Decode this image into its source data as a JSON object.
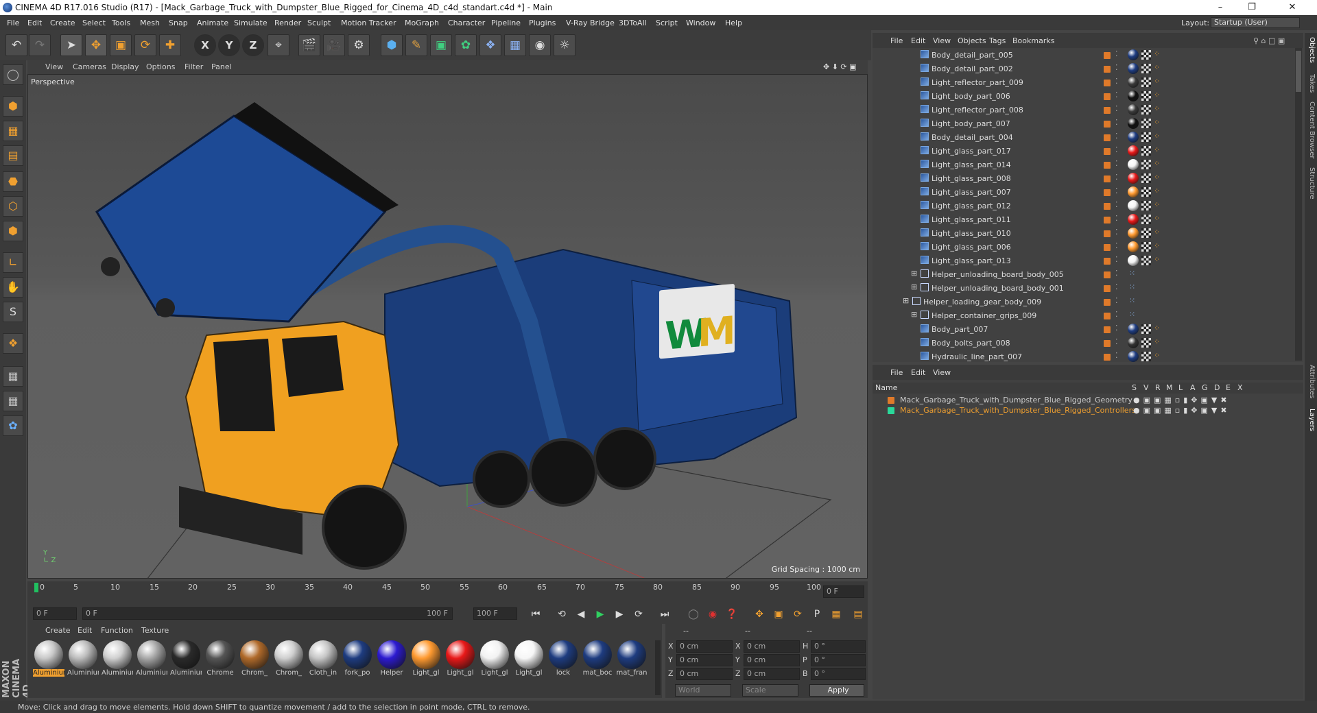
{
  "app": {
    "title": "CINEMA 4D R17.016 Studio (R17) - [Mack_Garbage_Truck_with_Dumpster_Blue_Rigged_for_Cinema_4D_c4d_standart.c4d *] - Main"
  },
  "menus": [
    "File",
    "Edit",
    "Create",
    "Select",
    "Tools",
    "Mesh",
    "Snap",
    "Animate",
    "Simulate",
    "Render",
    "Sculpt",
    "Motion Tracker",
    "MoGraph",
    "Character",
    "Pipeline",
    "Plugins",
    "V-Ray Bridge",
    "3DToAll",
    "Script",
    "Window",
    "Help"
  ],
  "layout": {
    "label": "Layout:",
    "value": "Startup (User)"
  },
  "viewport": {
    "menu": [
      "View",
      "Cameras",
      "Display",
      "Options",
      "Filter",
      "Panel"
    ],
    "camera": "Perspective",
    "grid_spacing": "Grid Spacing : 1000 cm"
  },
  "timeline": {
    "ticks": [
      "0",
      "5",
      "10",
      "15",
      "20",
      "25",
      "30",
      "35",
      "40",
      "45",
      "50",
      "55",
      "60",
      "65",
      "70",
      "75",
      "80",
      "85",
      "90",
      "95",
      "100"
    ],
    "current": "0 F",
    "start": "0 F",
    "range_left": "0 F",
    "range_right": "100 F",
    "end": "100 F"
  },
  "materials": {
    "menu": [
      "Create",
      "Edit",
      "Function",
      "Texture"
    ],
    "items": [
      {
        "label": "Aluminium",
        "color": "#c8c8c8",
        "selected": true
      },
      {
        "label": "Aluminium",
        "color": "#bcbcbc"
      },
      {
        "label": "Aluminium",
        "color": "#d0d0d0"
      },
      {
        "label": "Aluminium",
        "color": "#a8a8a8"
      },
      {
        "label": "Aluminium",
        "color": "#2a2a2a"
      },
      {
        "label": "Chrome",
        "color": "#555"
      },
      {
        "label": "Chrom_",
        "color": "#b06a2a"
      },
      {
        "label": "Chrom_",
        "color": "#cfcfcf"
      },
      {
        "label": "Cloth_in",
        "color": "#c6c6c6"
      },
      {
        "label": "fork_po",
        "color": "#1e3c80"
      },
      {
        "label": "Helper",
        "color": "#2c1ad0"
      },
      {
        "label": "Light_gl",
        "color": "#ff9a30"
      },
      {
        "label": "Light_gl",
        "color": "#e81818"
      },
      {
        "label": "Light_gl",
        "color": "#f2f2f2"
      },
      {
        "label": "Light_gl",
        "color": "#f6f6f6"
      },
      {
        "label": "lock",
        "color": "#1e3c80"
      },
      {
        "label": "mat_boc",
        "color": "#1e3c80"
      },
      {
        "label": "mat_fran",
        "color": "#1e3c80"
      }
    ]
  },
  "coords": {
    "headers": [
      "--",
      "--",
      "--"
    ],
    "rows": [
      {
        "a": "X",
        "av": "0 cm",
        "b": "X",
        "bv": "0 cm",
        "c": "H",
        "cv": "0 °"
      },
      {
        "a": "Y",
        "av": "0 cm",
        "b": "Y",
        "bv": "0 cm",
        "c": "P",
        "cv": "0 °"
      },
      {
        "a": "Z",
        "av": "0 cm",
        "b": "Z",
        "bv": "0 cm",
        "c": "B",
        "cv": "0 °"
      }
    ],
    "world": "World",
    "scale": "Scale",
    "apply": "Apply"
  },
  "object_manager": {
    "menu": [
      "File",
      "Edit",
      "View",
      "Objects",
      "Tags",
      "Bookmarks"
    ],
    "rows": [
      {
        "name": "Body_detail_part_005",
        "indent": 2,
        "type": "mesh",
        "swatch": "#1e3c80"
      },
      {
        "name": "Body_detail_part_002",
        "indent": 2,
        "type": "mesh",
        "swatch": "#1e3c80"
      },
      {
        "name": "Light_reflector_part_009",
        "indent": 2,
        "type": "mesh",
        "swatch": "#3a3a3a"
      },
      {
        "name": "Light_body_part_006",
        "indent": 2,
        "type": "mesh",
        "swatch": "#111"
      },
      {
        "name": "Light_reflector_part_008",
        "indent": 2,
        "type": "mesh",
        "swatch": "#3a3a3a"
      },
      {
        "name": "Light_body_part_007",
        "indent": 2,
        "type": "mesh",
        "swatch": "#111"
      },
      {
        "name": "Body_detail_part_004",
        "indent": 2,
        "type": "mesh",
        "swatch": "#1e3c80"
      },
      {
        "name": "Light_glass_part_017",
        "indent": 2,
        "type": "mesh",
        "swatch": "#e81818"
      },
      {
        "name": "Light_glass_part_014",
        "indent": 2,
        "type": "mesh",
        "swatch": "#f4f4f4"
      },
      {
        "name": "Light_glass_part_008",
        "indent": 2,
        "type": "mesh",
        "swatch": "#e81818"
      },
      {
        "name": "Light_glass_part_007",
        "indent": 2,
        "type": "mesh",
        "swatch": "#ff9a30"
      },
      {
        "name": "Light_glass_part_012",
        "indent": 2,
        "type": "mesh",
        "swatch": "#f4f4f4"
      },
      {
        "name": "Light_glass_part_011",
        "indent": 2,
        "type": "mesh",
        "swatch": "#e81818"
      },
      {
        "name": "Light_glass_part_010",
        "indent": 2,
        "type": "mesh",
        "swatch": "#ff9a30"
      },
      {
        "name": "Light_glass_part_006",
        "indent": 2,
        "type": "mesh",
        "swatch": "#ff9a30"
      },
      {
        "name": "Light_glass_part_013",
        "indent": 2,
        "type": "mesh",
        "swatch": "#f4f4f4"
      },
      {
        "name": "Helper_unloading_board_body_005",
        "indent": 2,
        "type": "null",
        "swatch": ""
      },
      {
        "name": "Helper_unloading_board_body_001",
        "indent": 2,
        "type": "null",
        "swatch": ""
      },
      {
        "name": "Helper_loading_gear_body_009",
        "indent": 1,
        "type": "null",
        "swatch": ""
      },
      {
        "name": "Helper_container_grips_009",
        "indent": 2,
        "type": "null",
        "swatch": ""
      },
      {
        "name": "Body_part_007",
        "indent": 2,
        "type": "mesh",
        "swatch": "#1e3c80"
      },
      {
        "name": "Body_bolts_part_008",
        "indent": 2,
        "type": "mesh",
        "swatch": "#333"
      },
      {
        "name": "Hydraulic_line_part_007",
        "indent": 2,
        "type": "mesh",
        "swatch": "#1e3c80"
      }
    ]
  },
  "layer_manager": {
    "menu": [
      "File",
      "Edit",
      "View"
    ],
    "columns": [
      "Name",
      "S",
      "V",
      "R",
      "M",
      "L",
      "A",
      "G",
      "D",
      "E",
      "X"
    ],
    "rows": [
      {
        "name": "Mack_Garbage_Truck_with_Dumpster_Blue_Rigged_Geometry",
        "color": "#e07a2a"
      },
      {
        "name": "Mack_Garbage_Truck_with_Dumpster_Blue_Rigged_Controllers",
        "color": "#2ad89a"
      }
    ]
  },
  "side_tabs": [
    "Objects",
    "Takes",
    "Content Browser",
    "Structure",
    "Attributes",
    "Layers"
  ],
  "status": "Move: Click and drag to move elements. Hold down SHIFT to quantize movement / add to the selection in point mode, CTRL to remove.",
  "brand": "MAXON CINEMA 4D"
}
